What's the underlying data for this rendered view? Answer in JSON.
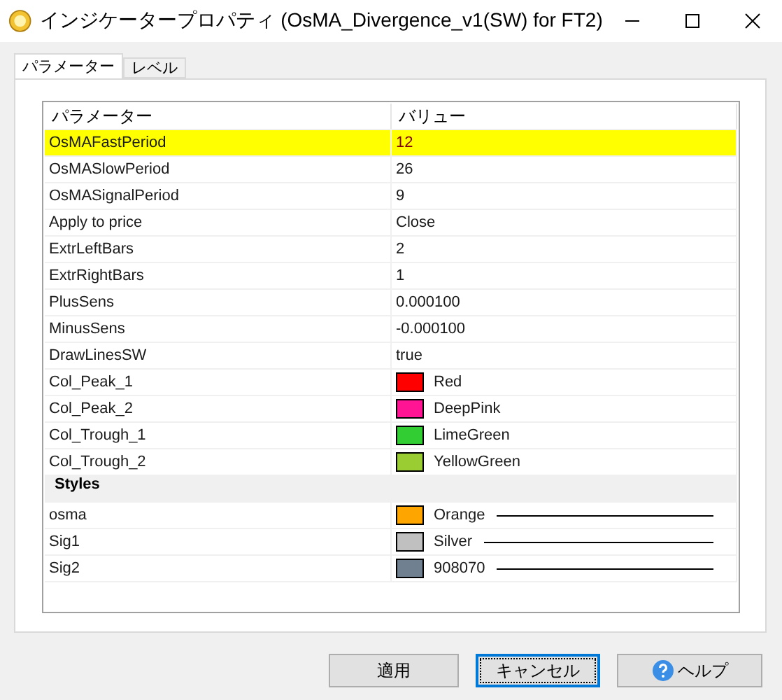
{
  "window": {
    "title": "インジケータープロパティ (OsMA_Divergence_v1(SW) for FT2)"
  },
  "tabs": [
    {
      "label": "パラメーター",
      "selected": true
    },
    {
      "label": "レベル",
      "selected": false
    }
  ],
  "table": {
    "columns": [
      "パラメーター",
      "バリュー"
    ],
    "rows": [
      {
        "kind": "param",
        "name": "OsMAFastPeriod",
        "value": "12",
        "selected": true
      },
      {
        "kind": "param",
        "name": "OsMASlowPeriod",
        "value": "26",
        "selected": false
      },
      {
        "kind": "param",
        "name": "OsMASignalPeriod",
        "value": "9",
        "selected": false
      },
      {
        "kind": "param",
        "name": "Apply to price",
        "value": "Close",
        "selected": false
      },
      {
        "kind": "param",
        "name": "ExtrLeftBars",
        "value": "2",
        "selected": false
      },
      {
        "kind": "param",
        "name": "ExtrRightBars",
        "value": "1",
        "selected": false
      },
      {
        "kind": "param",
        "name": "PlusSens",
        "value": "0.000100",
        "selected": false
      },
      {
        "kind": "param",
        "name": "MinusSens",
        "value": "-0.000100",
        "selected": false
      },
      {
        "kind": "param",
        "name": "DrawLinesSW",
        "value": "true",
        "selected": false
      },
      {
        "kind": "color",
        "name": "Col_Peak_1",
        "value": "Red",
        "color": "#ff0000",
        "selected": false
      },
      {
        "kind": "color",
        "name": "Col_Peak_2",
        "value": "DeepPink",
        "color": "#ff1493",
        "selected": false
      },
      {
        "kind": "color",
        "name": "Col_Trough_1",
        "value": "LimeGreen",
        "color": "#32cd32",
        "selected": false
      },
      {
        "kind": "color",
        "name": "Col_Trough_2",
        "value": "YellowGreen",
        "color": "#9acd32",
        "selected": false
      },
      {
        "kind": "section",
        "name": "Styles"
      },
      {
        "kind": "style",
        "name": "osma",
        "value": "Orange",
        "color": "#ffa500",
        "selected": false
      },
      {
        "kind": "style",
        "name": "Sig1",
        "value": "Silver",
        "color": "#c0c0c0",
        "selected": false
      },
      {
        "kind": "style",
        "name": "Sig2",
        "value": "908070",
        "color": "#708090",
        "selected": false
      }
    ]
  },
  "buttons": [
    {
      "label": "適用",
      "kind": "plain",
      "focused": false
    },
    {
      "label": "キャンセル",
      "kind": "plain",
      "focused": true
    },
    {
      "label": "ヘルプ",
      "kind": "help",
      "focused": false
    }
  ]
}
